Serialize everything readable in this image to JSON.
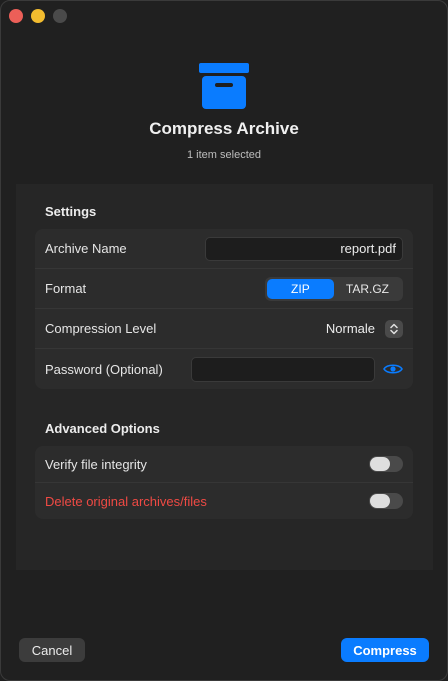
{
  "window": {
    "controls": [
      "close",
      "minimize",
      "zoom"
    ]
  },
  "header": {
    "icon": "archive-box-icon",
    "title": "Compress Archive",
    "subtitle": "1 item selected",
    "accent_color": "#0a7cff"
  },
  "settings": {
    "section_title": "Settings",
    "archive_name": {
      "label": "Archive Name",
      "value": "report.pdf"
    },
    "format": {
      "label": "Format",
      "options": [
        "ZIP",
        "TAR.GZ"
      ],
      "selected": "ZIP"
    },
    "compression_level": {
      "label": "Compression Level",
      "value": "Normale"
    },
    "password": {
      "label": "Password (Optional)",
      "value": "",
      "icon": "eye-icon"
    }
  },
  "advanced": {
    "section_title": "Advanced Options",
    "verify": {
      "label": "Verify file integrity",
      "enabled": false
    },
    "delete_original": {
      "label": "Delete original archives/files",
      "enabled": false,
      "color": "#ef4a44"
    }
  },
  "footer": {
    "cancel_label": "Cancel",
    "compress_label": "Compress"
  }
}
